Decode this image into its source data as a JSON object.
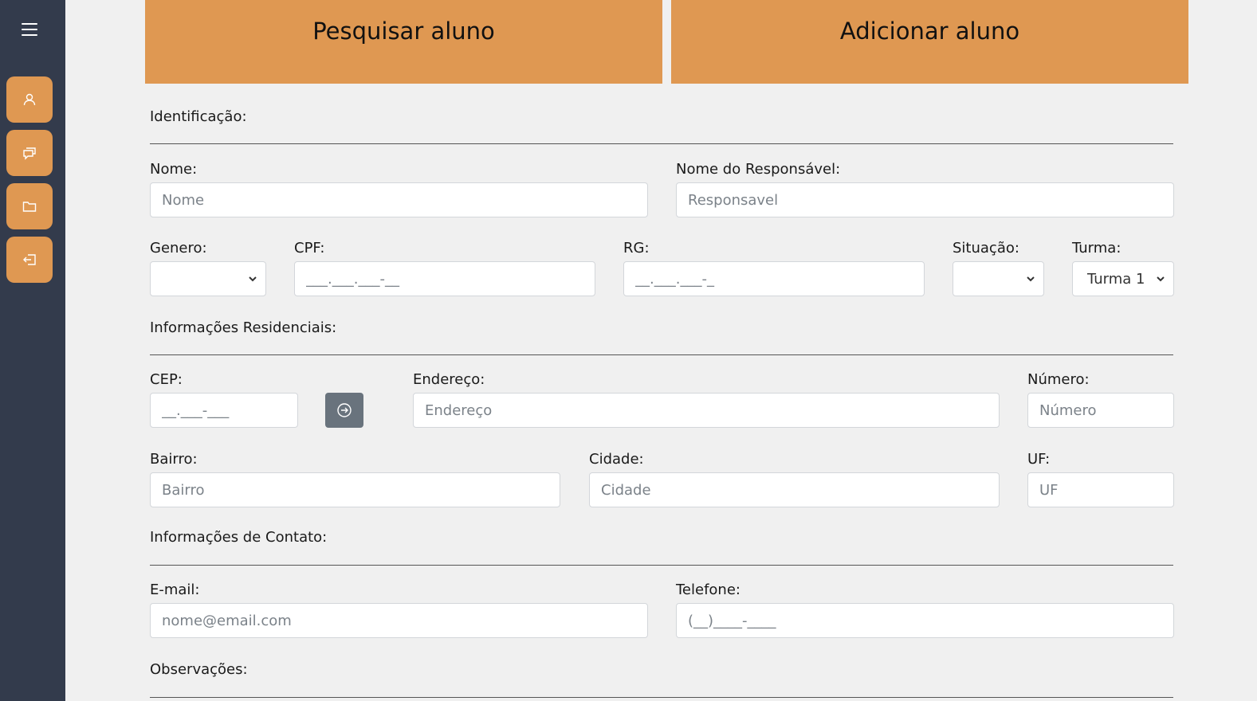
{
  "top_buttons": {
    "search": "Pesquisar aluno",
    "add": "Adicionar aluno"
  },
  "sections": {
    "identification": "Identificação:",
    "residential": "Informações Residenciais:",
    "contact": "Informações de Contato:",
    "notes": "Observações:"
  },
  "fields": {
    "nome": {
      "label": "Nome:",
      "placeholder": "Nome"
    },
    "responsavel": {
      "label": "Nome do Responsável:",
      "placeholder": "Responsavel"
    },
    "genero": {
      "label": "Genero:",
      "value": ""
    },
    "cpf": {
      "label": "CPF:",
      "placeholder": "___.___.___-__"
    },
    "rg": {
      "label": "RG:",
      "placeholder": "__.___.___-_"
    },
    "situacao": {
      "label": "Situação:",
      "value": ""
    },
    "turma": {
      "label": "Turma:",
      "value": "Turma 1"
    },
    "cep": {
      "label": "CEP:",
      "placeholder": "__.___-___"
    },
    "endereco": {
      "label": "Endereço:",
      "placeholder": "Endereço"
    },
    "numero": {
      "label": "Número:",
      "placeholder": "Número"
    },
    "bairro": {
      "label": "Bairro:",
      "placeholder": "Bairro"
    },
    "cidade": {
      "label": "Cidade:",
      "placeholder": "Cidade"
    },
    "uf": {
      "label": "UF:",
      "placeholder": "UF"
    },
    "email": {
      "label": "E-mail:",
      "placeholder": "nome@email.com"
    },
    "telefone": {
      "label": "Telefone:",
      "placeholder": "(__)____-____"
    }
  },
  "sidebar": {
    "menu_icon": "hamburger-menu-icon",
    "items": [
      {
        "icon": "user-icon"
      },
      {
        "icon": "chat-icon"
      },
      {
        "icon": "folder-icon"
      },
      {
        "icon": "logout-icon"
      }
    ]
  },
  "colors": {
    "sidebar": "#333b4c",
    "accent": "#df9852",
    "background": "#f0f0f0",
    "cep_button": "#69737d"
  }
}
